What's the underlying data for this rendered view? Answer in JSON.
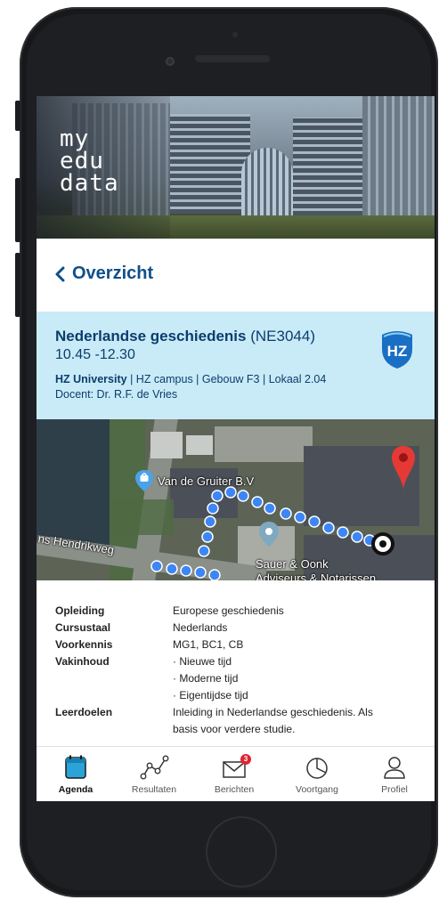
{
  "hero": {
    "logo_lines": [
      "my",
      "edu",
      "data"
    ]
  },
  "nav": {
    "back_label": "Overzicht"
  },
  "course": {
    "name": "Nederlandse geschiedenis",
    "code": "(NE3044)",
    "time": "10.45 -12.30",
    "institution": "HZ University",
    "location": " | HZ campus | Gebouw F3 | Lokaal 2.04",
    "teacher": "Docent: Dr. R.F. de Vries",
    "badge_text": "HZ"
  },
  "map": {
    "labels": {
      "company1": "Van de Gruiter B.V",
      "company2": "Sauer & Oonk",
      "company2_line2": "Adviseurs & Notarissen",
      "street": "ns Hendrikweg"
    },
    "route_color": "#3d86f5",
    "pin_color": "#e53935"
  },
  "details": [
    {
      "key": "Opleiding",
      "value": "Europese geschiedenis"
    },
    {
      "key": "Cursustaal",
      "value": "Nederlands"
    },
    {
      "key": "Voorkennis",
      "value": "MG1, BC1, CB"
    },
    {
      "key": "Vakinhoud",
      "value": "· Nieuwe tijd"
    },
    {
      "key": "",
      "value": "· Moderne tijd"
    },
    {
      "key": "",
      "value": "· Eigentijdse tijd"
    },
    {
      "key": "Leerdoelen",
      "value": "Inleiding in Nederlandse geschiedenis. Als"
    },
    {
      "key": "",
      "value": "basis voor verdere studie."
    }
  ],
  "tabs": [
    {
      "label": "Agenda",
      "icon": "calendar-icon",
      "active": true
    },
    {
      "label": "Resultaten",
      "icon": "chart-line-icon"
    },
    {
      "label": "Berichten",
      "icon": "mail-icon",
      "badge": "3"
    },
    {
      "label": "Voortgang",
      "icon": "pie-chart-icon"
    },
    {
      "label": "Profiel",
      "icon": "person-icon"
    }
  ],
  "colors": {
    "accent": "#0f4f8a",
    "course_bg": "#c9ebf7",
    "tab_active": "#2aa3d6",
    "badge": "#e0242f"
  }
}
